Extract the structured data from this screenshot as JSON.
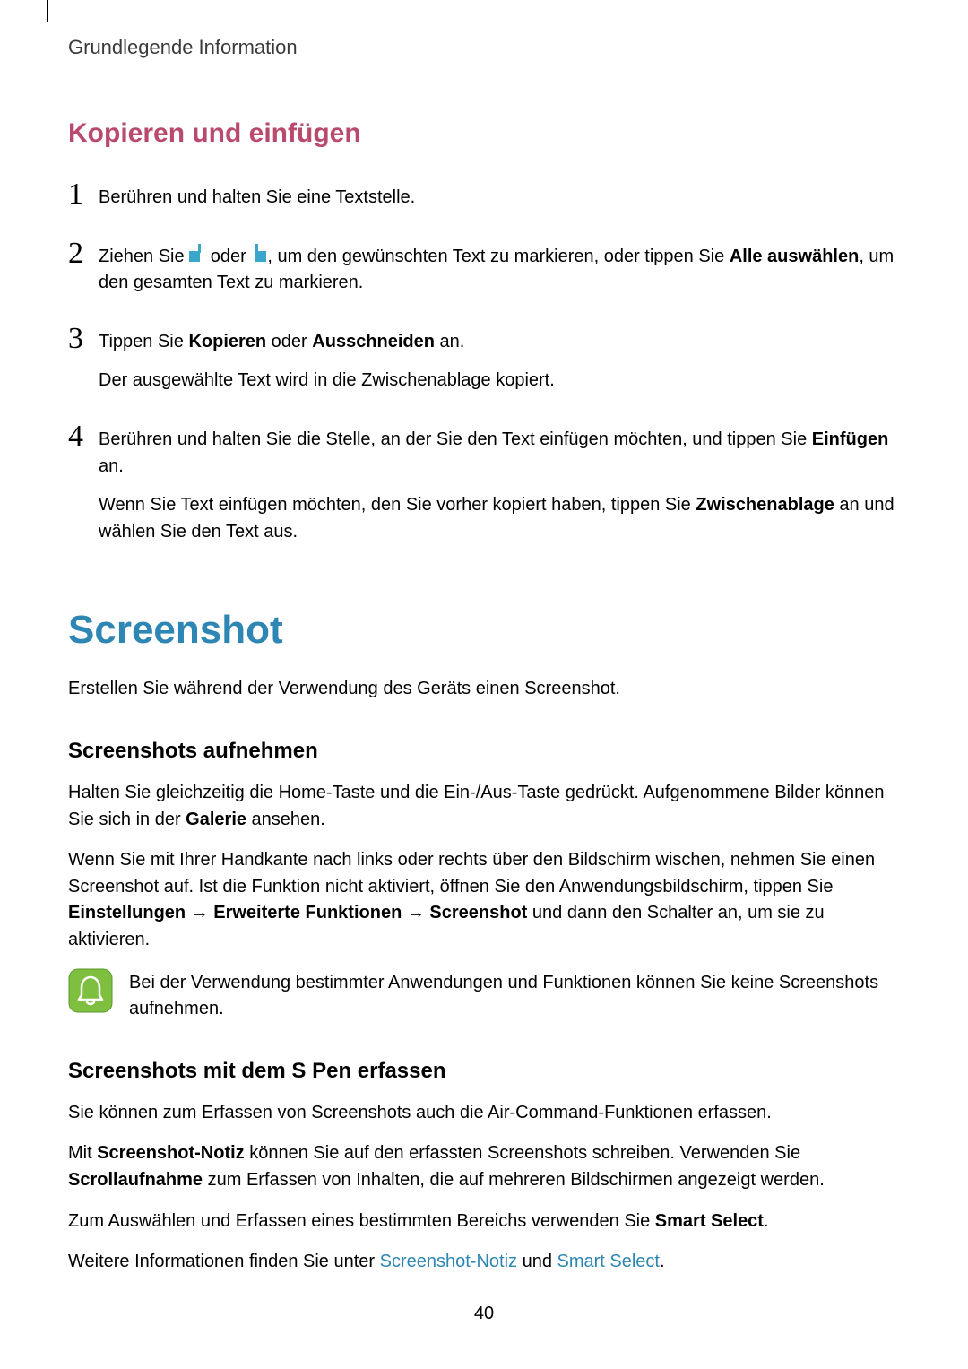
{
  "header": "Grundlegende Information",
  "copy_paste": {
    "title": "Kopieren und einfügen",
    "steps": {
      "s1_num": "1",
      "s1_text": "Berühren und halten Sie eine Textstelle.",
      "s2_num": "2",
      "s2_a": "Ziehen Sie ",
      "s2_b": " oder ",
      "s2_c": ", um den gewünschten Text zu markieren, oder tippen Sie ",
      "s2_bold": "Alle auswählen",
      "s2_d": ", um den gesamten Text zu markieren.",
      "s3_num": "3",
      "s3_a": "Tippen Sie ",
      "s3_b1": "Kopieren",
      "s3_c": " oder ",
      "s3_b2": "Ausschneiden",
      "s3_d": " an.",
      "s3_sub": "Der ausgewählte Text wird in die Zwischenablage kopiert.",
      "s4_num": "4",
      "s4_a": "Berühren und halten Sie die Stelle, an der Sie den Text einfügen möchten, und tippen Sie ",
      "s4_b": "Einfügen",
      "s4_c": " an.",
      "s4_sub_a": "Wenn Sie Text einfügen möchten, den Sie vorher kopiert haben, tippen Sie ",
      "s4_sub_b": "Zwischenablage",
      "s4_sub_c": " an und wählen Sie den Text aus."
    }
  },
  "screenshot": {
    "title": "Screenshot",
    "intro": "Erstellen Sie während der Verwendung des Geräts einen Screenshot.",
    "sub1_title": "Screenshots aufnehmen",
    "sub1_p1_a": "Halten Sie gleichzeitig die Home-Taste und die Ein-/Aus-Taste gedrückt. Aufgenommene Bilder können Sie sich in der ",
    "sub1_p1_b": "Galerie",
    "sub1_p1_c": " ansehen.",
    "sub1_p2_a": "Wenn Sie mit Ihrer Handkante nach links oder rechts über den Bildschirm wischen, nehmen Sie einen Screenshot auf. Ist die Funktion nicht aktiviert, öffnen Sie den Anwendungsbildschirm, tippen Sie ",
    "sub1_p2_b1": "Einstellungen",
    "sub1_p2_arrow1": " → ",
    "sub1_p2_b2": "Erweiterte Funktionen",
    "sub1_p2_arrow2": " → ",
    "sub1_p2_b3": "Screenshot",
    "sub1_p2_c": " und dann den Schalter an, um sie zu aktivieren.",
    "note": "Bei der Verwendung bestimmter Anwendungen und Funktionen können Sie keine Screenshots aufnehmen.",
    "sub2_title": "Screenshots mit dem S Pen erfassen",
    "sub2_p1": "Sie können zum Erfassen von Screenshots auch die Air-Command-Funktionen erfassen.",
    "sub2_p2_a": "Mit ",
    "sub2_p2_b1": "Screenshot-Notiz",
    "sub2_p2_b": " können Sie auf den erfassten Screenshots schreiben. Verwenden Sie ",
    "sub2_p2_b2": "Scrollaufnahme",
    "sub2_p2_c": " zum Erfassen von Inhalten, die auf mehreren Bildschirmen angezeigt werden.",
    "sub2_p3_a": "Zum Auswählen und Erfassen eines bestimmten Bereichs verwenden Sie ",
    "sub2_p3_b": "Smart Select",
    "sub2_p3_c": ".",
    "sub2_p4_a": "Weitere Informationen finden Sie unter ",
    "sub2_p4_link1": "Screenshot-Notiz",
    "sub2_p4_b": " und ",
    "sub2_p4_link2": "Smart Select",
    "sub2_p4_c": "."
  },
  "page_number": "40"
}
